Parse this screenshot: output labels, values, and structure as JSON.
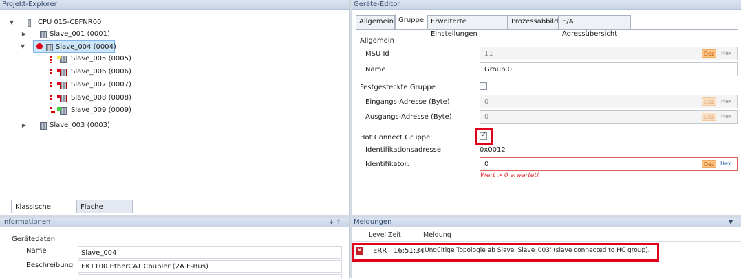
{
  "explorer": {
    "title": "Projekt-Explorer",
    "cpu": "CPU 015-CEFNR00",
    "nodes": [
      "Slave_001 (0001)",
      "Slave_004 (0004)",
      "Slave_005 (0005)",
      "Slave_006 (0006)",
      "Slave_007 (0007)",
      "Slave_008 (0008)",
      "Slave_009 (0009)",
      "Slave_003 (0003)"
    ],
    "view_tabs": [
      "Klassische Ansicht",
      "Flache Ansicht"
    ]
  },
  "editor": {
    "title": "Geräte-Editor",
    "tabs": [
      "Allgemein",
      "Gruppe",
      "Erweiterte Einstellungen",
      "Prozessabbild",
      "E/A Adressübersicht"
    ],
    "active_tab": "Gruppe",
    "section_general": "Allgemein",
    "msu_label": "MSU Id",
    "msu_value": "11",
    "name_label": "Name",
    "name_value": "Group 0",
    "fixed_label": "Festgesteckte Gruppe",
    "in_label": "Eingangs-Adresse (Byte)",
    "in_value": "0",
    "out_label": "Ausgangs-Adresse (Byte)",
    "out_value": "0",
    "hc_label": "Hot Connect Gruppe",
    "hc_checked": true,
    "idaddr_label": "Identifikationsadresse",
    "idaddr_value": "0x0012",
    "ident_label": "Identifikator:",
    "ident_value": "0",
    "ident_error": "Wert > 0 erwartet!",
    "dez": "Dez",
    "hex": "Hex"
  },
  "info": {
    "title": "Informationen",
    "pin": "↓ ↑",
    "group": "Gerätedaten",
    "name_label": "Name",
    "name_value": "Slave_004",
    "desc_label": "Beschreibung",
    "desc_value": "EK1100 EtherCAT Coupler (2A E-Bus)"
  },
  "messages": {
    "title": "Meldungen",
    "columns": [
      "Level",
      "Zeit",
      "Meldung"
    ],
    "rows": [
      {
        "level": "ERR",
        "time": "16:51:34",
        "text": "Ungültige Topologie ab Slave 'Slave_003' (slave connected to HC group)."
      }
    ]
  },
  "colors": {
    "accent_red": "#e0001b",
    "selection": "#cde6f7",
    "header": "#34496b"
  }
}
